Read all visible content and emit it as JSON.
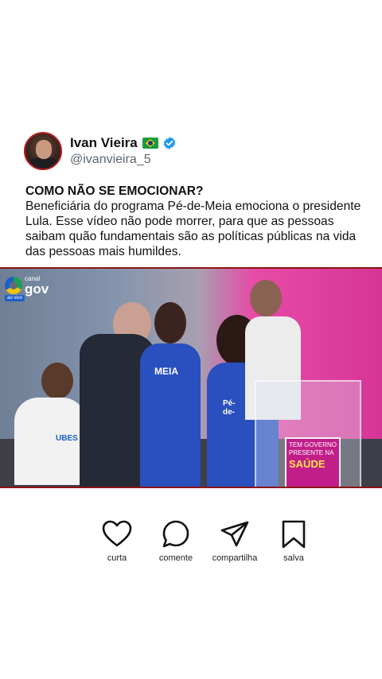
{
  "post": {
    "author": {
      "display_name": "Ivan Vieira",
      "handle": "@ivanvieira_5",
      "flag_icon": "brazil-flag-icon",
      "verified_icon": "verified-badge-icon",
      "verified_color": "#1d9bf0"
    },
    "headline": "COMO NÃO SE EMOCIONAR?",
    "body": "Beneficiária do programa Pé-de-Meia emociona o presidente Lula. Esse vídeo não pode morrer, para que as pessoas saibam quão fundamentais são as políticas públicas na vida das pessoas mais humildes."
  },
  "video": {
    "channel_small": "canal",
    "channel_big": "gov",
    "live_label": "ao vivo",
    "shirt_text_1": "Pé-de-",
    "shirt_text_2": "MEIA",
    "shirt_text_3": "UBES",
    "podium_line": "TEM GOVERNO PRESENTE NA",
    "podium_big": "SAÚDE",
    "accent_color": "#d73596"
  },
  "actions": [
    {
      "label": "curta",
      "icon": "heart-icon"
    },
    {
      "label": "comente",
      "icon": "comment-icon"
    },
    {
      "label": "compartilha",
      "icon": "share-icon"
    },
    {
      "label": "salva",
      "icon": "bookmark-icon"
    }
  ]
}
